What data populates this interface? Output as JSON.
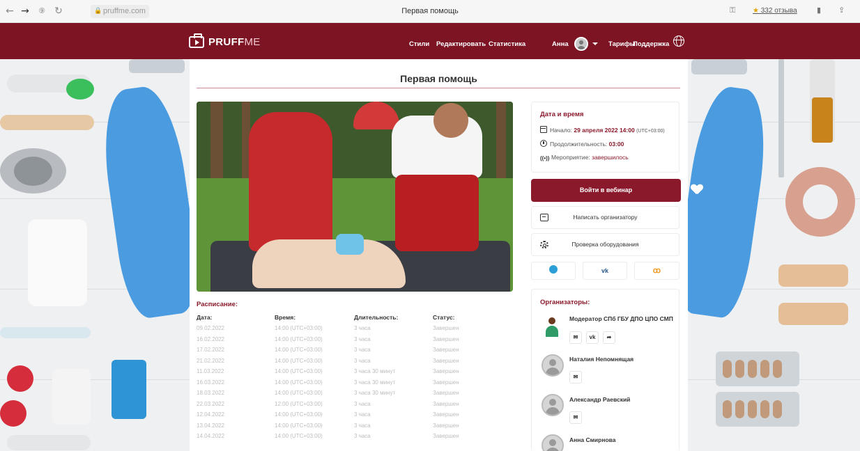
{
  "browser": {
    "back": "←",
    "forward": "→",
    "reload": "↻",
    "url": "pruffme.com",
    "tab_title": "Первая помощь",
    "reviews": "332 отзыва"
  },
  "header": {
    "logo_main": "PRUFF",
    "logo_suffix": "ME",
    "nav": [
      "Стили",
      "Редактировать",
      "Статистика"
    ],
    "user_name": "Анна",
    "nav_right": [
      "Тарифы",
      "Поддержка"
    ]
  },
  "page": {
    "title": "Первая помощь"
  },
  "event": {
    "section_title": "Дата и время",
    "start_label": "Начало:",
    "start_value": "29 апреля 2022 14:00",
    "timezone": "(UTC+03:00)",
    "duration_label": "Продолжительность:",
    "duration_value": "03:00",
    "status_label": "Мероприятие:",
    "status_value": "завершилось"
  },
  "actions": {
    "join": "Войти в вебинар",
    "message": "Написать организатору",
    "check": "Проверка оборудования",
    "vk": "vk",
    "ok": "ꝏ"
  },
  "organizers": {
    "title": "Организаторы:",
    "list": [
      {
        "name": "Модератор СПб ГБУ ДПО ЦПО СМП"
      },
      {
        "name": "Наталия Непомнящая"
      },
      {
        "name": "Александр Раевский"
      },
      {
        "name": "Анна Смирнова"
      }
    ],
    "mail_icon": "✉",
    "vk_icon": "vk",
    "share_icon": "➦"
  },
  "schedule": {
    "title": "Расписание:",
    "headers": [
      "Дата:",
      "Время:",
      "Длительность:",
      "Статус:"
    ],
    "rows": [
      [
        "09.02.2022",
        "14:00 (UTC+03:00)",
        "3 часа",
        "Завершен"
      ],
      [
        "16.02.2022",
        "14:00 (UTC+03:00)",
        "3 часа",
        "Завершен"
      ],
      [
        "17.02.2022",
        "14:00 (UTC+03:00)",
        "3 часа",
        "Завершен"
      ],
      [
        "21.02.2022",
        "14:00 (UTC+03:00)",
        "3 часа",
        "Завершен"
      ],
      [
        "11.03.2022",
        "14:00 (UTC+03:00)",
        "3 часа 30 минут",
        "Завершен"
      ],
      [
        "16.03.2022",
        "14:00 (UTC+03:00)",
        "3 часа 30 минут",
        "Завершен"
      ],
      [
        "18.03.2022",
        "14:00 (UTC+03:00)",
        "3 часа 30 минут",
        "Завершен"
      ],
      [
        "22.03.2022",
        "12:00 (UTC+03:00)",
        "3 часа",
        "Завершен"
      ],
      [
        "12.04.2022",
        "14:00 (UTC+03:00)",
        "3 часа",
        "Завершен"
      ],
      [
        "13.04.2022",
        "14:00 (UTC+03:00)",
        "3 часа",
        "Завершен"
      ],
      [
        "14.04.2022",
        "14:00 (UTC+03:00)",
        "3 часа",
        "Завершен"
      ]
    ]
  },
  "colors": {
    "brand": "#7d1424",
    "accent": "#8a1a2b"
  }
}
